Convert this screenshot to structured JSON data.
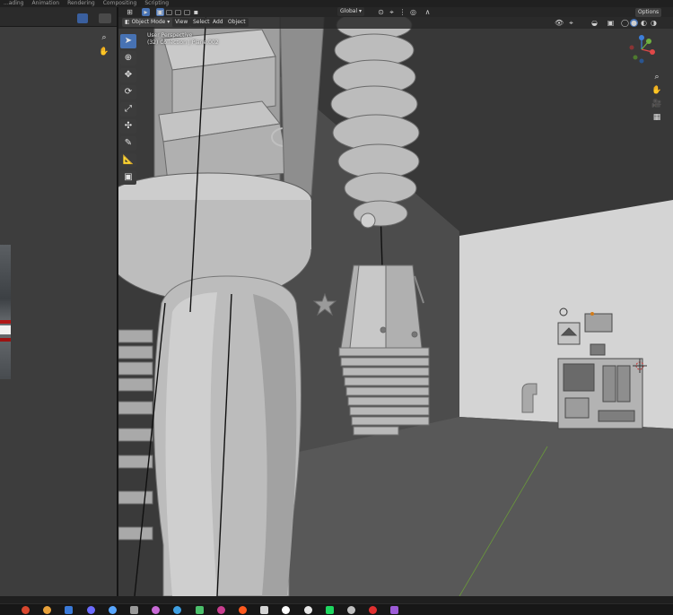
{
  "workspace_tabs": [
    "...ading",
    "Animation",
    "Rendering",
    "Compositing",
    "Scripting"
  ],
  "viewport_header": {
    "mode": "Object Mode",
    "menus": [
      "View",
      "Select",
      "Add",
      "Object"
    ],
    "transform_orientation": "Global",
    "options": "Options"
  },
  "viewport_info": {
    "perspective": "User Perspective",
    "collection": "(32) Collection | Plane.002"
  },
  "left_tools": [
    "zoom-icon",
    "hand-icon"
  ],
  "toolbar_tools": [
    "select-box-icon",
    "cursor-icon",
    "move-icon",
    "rotate-icon",
    "scale-icon",
    "transform-icon",
    "annotate-icon",
    "measure-icon",
    "add-cube-icon"
  ],
  "nav_tools": [
    "zoom-icon",
    "hand-icon",
    "camera-icon",
    "grid-icon"
  ],
  "gizmo_axes": {
    "x": "#e04848",
    "y": "#6fb03f",
    "z": "#3d7fd9"
  },
  "taskbar_icons": [
    "#d8472e",
    "#e8a13a",
    "#3a7ad8",
    "#6c6cff",
    "#58a6ff",
    "#9a9a9a",
    "#c86ad6",
    "#3fa0e3",
    "#4bbf6b",
    "#c83e8f",
    "#ff5a1f",
    "#d4d4d4",
    "#ffffff",
    "#e8e8e8",
    "#1ed760",
    "#c0c0c0",
    "#e03030",
    "#9c5bd6"
  ],
  "colors": {
    "accent": "#4772b3",
    "header": "#262626",
    "panel": "#3d3d3d",
    "viewport_wall": "#4a4a4a",
    "floor": "#575757"
  }
}
